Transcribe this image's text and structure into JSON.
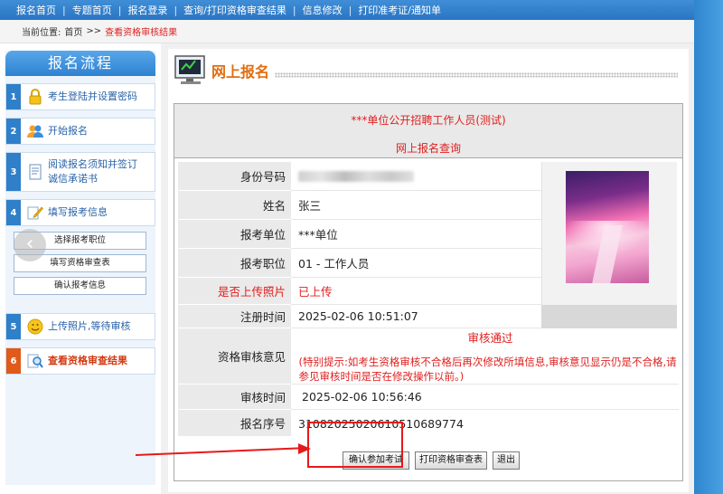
{
  "topnav": {
    "items": [
      "报名首页",
      "专题首页",
      "报名登录",
      "查询/打印资格审查结果",
      "信息修改",
      "打印准考证/通知单"
    ],
    "separator": "|"
  },
  "breadcrumb": {
    "prefix": "当前位置:",
    "home": "首页",
    "arrow": ">>",
    "current": "查看资格审核结果"
  },
  "sidebar": {
    "title": "报名流程",
    "steps": [
      {
        "num": "1",
        "label": "考生登陆并设置密码",
        "icon": "lock-icon"
      },
      {
        "num": "2",
        "label": "开始报名",
        "icon": "users-icon"
      },
      {
        "num": "3",
        "label": "阅读报名须知并签订诚信承诺书",
        "icon": "document-icon"
      },
      {
        "num": "4",
        "label": "填写报考信息",
        "icon": "pencil-icon"
      },
      {
        "num": "5",
        "label": "上传照片,等待审核",
        "icon": "smiley-icon"
      },
      {
        "num": "6",
        "label": "查看资格审查结果",
        "icon": "magnifier-icon"
      }
    ],
    "substeps": [
      "选择报考职位",
      "填写资格审查表",
      "确认报考信息"
    ],
    "back_glyph": "‹"
  },
  "main": {
    "section_title": "网上报名",
    "header_line1": "***单位公开招聘工作人员(测试)",
    "header_line2": "网上报名查询",
    "fields": {
      "id_label": "身份号码",
      "name_label": "姓名",
      "name_value": "张三",
      "unit_label": "报考单位",
      "unit_value": "***单位",
      "position_label": "报考职位",
      "position_value": "01 - 工作人员",
      "photo_label": "是否上传照片",
      "photo_value": "已上传",
      "register_label": "注册时间",
      "register_value": "2025-02-06 10:51:07",
      "opinion_label": "资格审核意见",
      "opinion_status": "审核通过",
      "opinion_note": "(特别提示:如考生资格审核不合格后再次修改所填信息,审核意见显示仍是不合格,请参见审核时间是否在修改操作以前。)",
      "review_time_label": "审核时间",
      "review_time_value": "2025-02-06 10:56:46",
      "serial_label": "报名序号",
      "serial_value": "31082025020610510689774"
    },
    "buttons": {
      "confirm": "确认参加考试",
      "print": "打印资格审查表",
      "exit": "退出"
    }
  },
  "colors": {
    "nav_blue": "#2b75c2",
    "title_orange": "#e06e10",
    "alert_red": "#e02020",
    "annotation_red": "#e81818"
  }
}
